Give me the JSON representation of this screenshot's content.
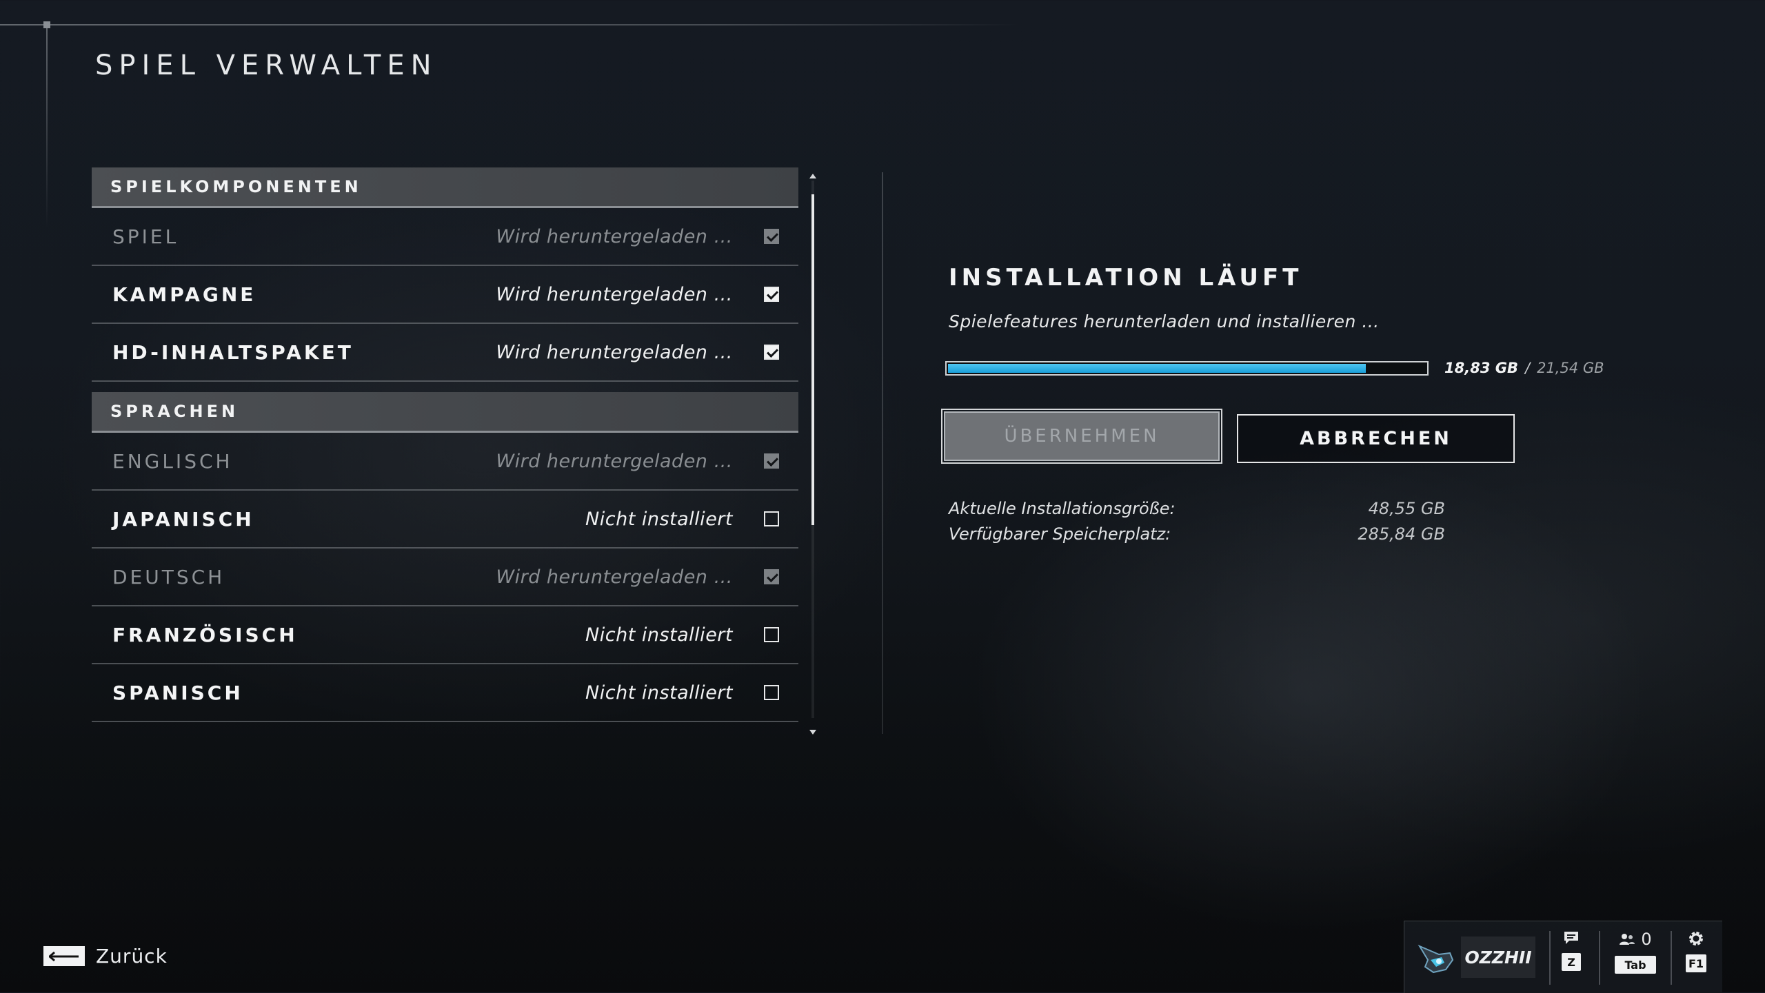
{
  "page": {
    "title": "SPIEL VERWALTEN"
  },
  "components": {
    "sections": [
      {
        "header": "SPIELKOMPONENTEN",
        "items": [
          {
            "name": "SPIEL",
            "status": "Wird heruntergeladen …",
            "checked": true,
            "disabled": true
          },
          {
            "name": "KAMPAGNE",
            "status": "Wird heruntergeladen …",
            "checked": true,
            "disabled": false
          },
          {
            "name": "HD-INHALTSPAKET",
            "status": "Wird heruntergeladen …",
            "checked": true,
            "disabled": false
          }
        ]
      },
      {
        "header": "SPRACHEN",
        "items": [
          {
            "name": "ENGLISCH",
            "status": "Wird heruntergeladen …",
            "checked": true,
            "disabled": true
          },
          {
            "name": "JAPANISCH",
            "status": "Nicht installiert",
            "checked": false,
            "disabled": false
          },
          {
            "name": "DEUTSCH",
            "status": "Wird heruntergeladen …",
            "checked": true,
            "disabled": true
          },
          {
            "name": "FRANZÖSISCH",
            "status": "Nicht installiert",
            "checked": false,
            "disabled": false
          },
          {
            "name": "SPANISCH",
            "status": "Nicht installiert",
            "checked": false,
            "disabled": false
          }
        ]
      }
    ]
  },
  "install": {
    "title": "INSTALLATION LÄUFT",
    "subtitle": "Spielefeatures herunterladen und installieren …",
    "progress": {
      "current": "18,83 GB",
      "separator": "/",
      "total": "21,54 GB",
      "fraction": 0.874
    },
    "apply_label": "ÜBERNEHMEN",
    "cancel_label": "ABBRECHEN",
    "current_size_label": "Aktuelle Installationsgröße:",
    "current_size_value": "48,55 GB",
    "free_space_label": "Verfügbarer Speicherplatz:",
    "free_space_value": "285,84 GB"
  },
  "footer": {
    "back_label": "Zurück",
    "gamertag": "OZZHII",
    "chat_key": "Z",
    "friends_count": "0",
    "friends_key": "Tab",
    "settings_key": "F1"
  },
  "colors": {
    "progress_fill": "#2bb3ea",
    "section_header_bg": "#45484c"
  },
  "icons": [
    "back-arrow-icon",
    "chat-icon",
    "friends-icon",
    "gear-icon",
    "player-emblem-icon",
    "checkbox-check-icon"
  ]
}
